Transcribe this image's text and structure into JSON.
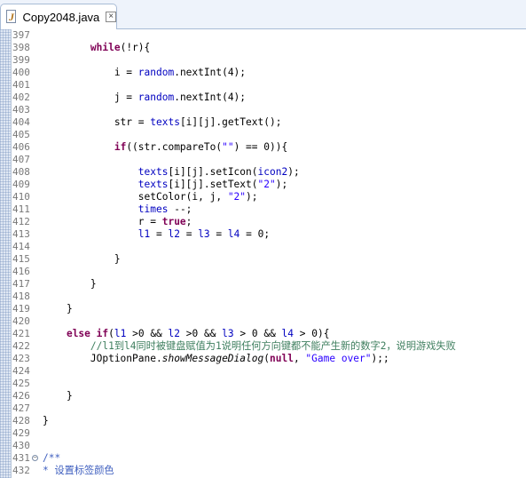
{
  "tab": {
    "file_name": "Copy2048.java",
    "close_glyph": "×",
    "icon": "java-file-icon"
  },
  "editor": {
    "lines": [
      {
        "n": "397",
        "segs": []
      },
      {
        "n": "398",
        "segs": [
          [
            "        ",
            ""
          ],
          [
            "while",
            "kw"
          ],
          [
            "(!r){",
            ""
          ]
        ]
      },
      {
        "n": "399",
        "segs": []
      },
      {
        "n": "400",
        "segs": [
          [
            "            i = ",
            ""
          ],
          [
            "random",
            "fld"
          ],
          [
            ".nextInt(4);",
            ""
          ]
        ]
      },
      {
        "n": "401",
        "segs": []
      },
      {
        "n": "402",
        "segs": [
          [
            "            j = ",
            ""
          ],
          [
            "random",
            "fld"
          ],
          [
            ".nextInt(4);",
            ""
          ]
        ]
      },
      {
        "n": "403",
        "segs": []
      },
      {
        "n": "404",
        "segs": [
          [
            "            str = ",
            ""
          ],
          [
            "texts",
            "fld"
          ],
          [
            "[i][j].getText();",
            ""
          ]
        ]
      },
      {
        "n": "405",
        "segs": []
      },
      {
        "n": "406",
        "segs": [
          [
            "            ",
            ""
          ],
          [
            "if",
            "kw"
          ],
          [
            "((str.compareTo(",
            ""
          ],
          [
            "\"\"",
            "str"
          ],
          [
            ") == 0)){",
            ""
          ]
        ]
      },
      {
        "n": "407",
        "segs": []
      },
      {
        "n": "408",
        "segs": [
          [
            "                ",
            ""
          ],
          [
            "texts",
            "fld"
          ],
          [
            "[i][j].setIcon(",
            ""
          ],
          [
            "icon2",
            "fld"
          ],
          [
            ");",
            ""
          ]
        ]
      },
      {
        "n": "409",
        "segs": [
          [
            "                ",
            ""
          ],
          [
            "texts",
            "fld"
          ],
          [
            "[i][j].setText(",
            ""
          ],
          [
            "\"2\"",
            "str"
          ],
          [
            ");",
            ""
          ]
        ]
      },
      {
        "n": "410",
        "segs": [
          [
            "                setColor(i, j, ",
            ""
          ],
          [
            "\"2\"",
            "str"
          ],
          [
            ");",
            ""
          ]
        ]
      },
      {
        "n": "411",
        "segs": [
          [
            "                ",
            ""
          ],
          [
            "times",
            "fld"
          ],
          [
            " --;",
            ""
          ]
        ]
      },
      {
        "n": "412",
        "segs": [
          [
            "                r = ",
            ""
          ],
          [
            "true",
            "kw"
          ],
          [
            ";",
            ""
          ]
        ]
      },
      {
        "n": "413",
        "segs": [
          [
            "                ",
            ""
          ],
          [
            "l1",
            "fld"
          ],
          [
            " = ",
            ""
          ],
          [
            "l2",
            "fld"
          ],
          [
            " = ",
            ""
          ],
          [
            "l3",
            "fld"
          ],
          [
            " = ",
            ""
          ],
          [
            "l4",
            "fld"
          ],
          [
            " = 0;",
            ""
          ]
        ]
      },
      {
        "n": "414",
        "segs": []
      },
      {
        "n": "415",
        "segs": [
          [
            "            }",
            ""
          ]
        ]
      },
      {
        "n": "416",
        "segs": []
      },
      {
        "n": "417",
        "segs": [
          [
            "        }",
            ""
          ]
        ]
      },
      {
        "n": "418",
        "segs": []
      },
      {
        "n": "419",
        "segs": [
          [
            "    }",
            ""
          ]
        ]
      },
      {
        "n": "420",
        "segs": []
      },
      {
        "n": "421",
        "segs": [
          [
            "    ",
            ""
          ],
          [
            "else",
            "kw"
          ],
          [
            " ",
            ""
          ],
          [
            "if",
            "kw"
          ],
          [
            "(",
            ""
          ],
          [
            "l1",
            "fld"
          ],
          [
            " >0 && ",
            ""
          ],
          [
            "l2",
            "fld"
          ],
          [
            " >0 && ",
            ""
          ],
          [
            "l3",
            "fld"
          ],
          [
            " > 0 && ",
            ""
          ],
          [
            "l4",
            "fld"
          ],
          [
            " > 0){",
            ""
          ]
        ]
      },
      {
        "n": "422",
        "segs": [
          [
            "        ",
            ""
          ],
          [
            "//l1到l4同时被键盘赋值为1说明任何方向键都不能产生新的数字2，说明游戏失败",
            "com"
          ]
        ]
      },
      {
        "n": "423",
        "segs": [
          [
            "        JOptionPane.",
            ""
          ],
          [
            "showMessageDialog",
            "ital"
          ],
          [
            "(",
            ""
          ],
          [
            "null",
            "kw"
          ],
          [
            ", ",
            ""
          ],
          [
            "\"Game over\"",
            "str"
          ],
          [
            ");;",
            ""
          ]
        ]
      },
      {
        "n": "424",
        "segs": []
      },
      {
        "n": "425",
        "segs": []
      },
      {
        "n": "426",
        "segs": [
          [
            "    }",
            ""
          ]
        ]
      },
      {
        "n": "427",
        "segs": []
      },
      {
        "n": "428",
        "segs": [
          [
            "}",
            ""
          ]
        ]
      },
      {
        "n": "429",
        "segs": []
      },
      {
        "n": "430",
        "segs": []
      },
      {
        "n": "431",
        "fold": "⊖",
        "segs": [
          [
            "/**",
            "jd"
          ]
        ]
      },
      {
        "n": "432",
        "segs": [
          [
            "* 设置标签颜色",
            "jd"
          ]
        ]
      }
    ]
  }
}
